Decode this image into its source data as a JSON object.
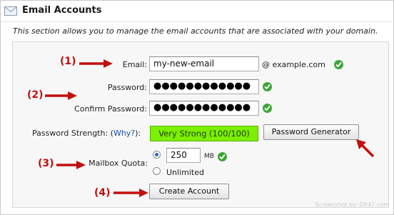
{
  "header": {
    "title": "Email Accounts"
  },
  "description": "This section allows you to manage the email accounts that are associated with your domain.",
  "form": {
    "email_label": "Email:",
    "email_value": "my-new-email",
    "domain_suffix": "@ example.com",
    "password_label": "Password:",
    "password_mask": "●●●●●●●●●●●●",
    "confirm_label": "Confirm Password:",
    "confirm_mask": "●●●●●●●●●●●●",
    "strength_label": "Password Strength: (",
    "why_link": "Why?",
    "strength_close": "):",
    "strength_value": "Very Strong (100/100)",
    "generator_button": "Password Generator",
    "quota_label": "Mailbox Quota:",
    "quota_value": "250",
    "quota_unit": "MB",
    "unlimited_label": "Unlimited",
    "create_button": "Create Account"
  },
  "annotations": {
    "step1": "(1)",
    "step2": "(2)",
    "step3": "(3)",
    "step4": "(4)"
  },
  "watermark": "Screenshot by: DR47.com",
  "colors": {
    "arrow": "#c40e0e",
    "strength_bg": "#7cf000",
    "check": "#3fa53a"
  }
}
